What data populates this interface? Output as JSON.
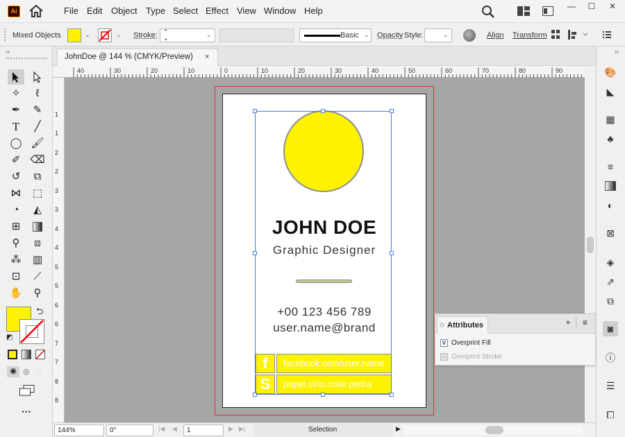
{
  "app": {
    "logo_text": "Ai"
  },
  "menu": {
    "items": [
      "File",
      "Edit",
      "Object",
      "Type",
      "Select",
      "Effect",
      "View",
      "Window",
      "Help"
    ]
  },
  "window_controls": {
    "minimize": "—",
    "maximize": "☐",
    "close": "✕"
  },
  "control_bar": {
    "selection_type": "Mixed Objects",
    "fill_color": "#fff200",
    "stroke_label": "Stroke:",
    "stroke_value": "",
    "brush_label": "Basic",
    "opacity_label": "Opacity",
    "style_label": "Style:",
    "align_label": "Align",
    "transform_label": "Transform"
  },
  "document_tab": {
    "label": "JohnDoe  @ 144 % (CMYK/Preview)",
    "close": "×"
  },
  "rulers": {
    "h_ticks": [
      "40",
      "30",
      "20",
      "10",
      "0",
      "10",
      "20",
      "30",
      "40",
      "50",
      "60",
      "70",
      "80",
      "90"
    ],
    "v_ticks": [
      "1",
      "1",
      "2",
      "2",
      "3",
      "3",
      "4",
      "4",
      "5",
      "5",
      "6",
      "6",
      "7",
      "7",
      "8",
      "8"
    ]
  },
  "card": {
    "name": "JOHN DOE",
    "title": "Graphic Designer",
    "phone": "+00 123 456 789",
    "email": "user.name@brand",
    "social": [
      {
        "icon_char": "f",
        "text": "facebook.com/user.name"
      },
      {
        "icon_char": "S",
        "text": "paper.sirio.color.pietra"
      }
    ],
    "accent_color": "#fff200"
  },
  "attributes_panel": {
    "title": "Attributes",
    "overprint_fill": "Overprint Fill",
    "overprint_stroke": "Overprint Stroke",
    "overprint_fill_checked": true
  },
  "status_bar": {
    "zoom": "144%",
    "rotation": "0°",
    "artboard_num": "1",
    "tool": "Selection"
  }
}
